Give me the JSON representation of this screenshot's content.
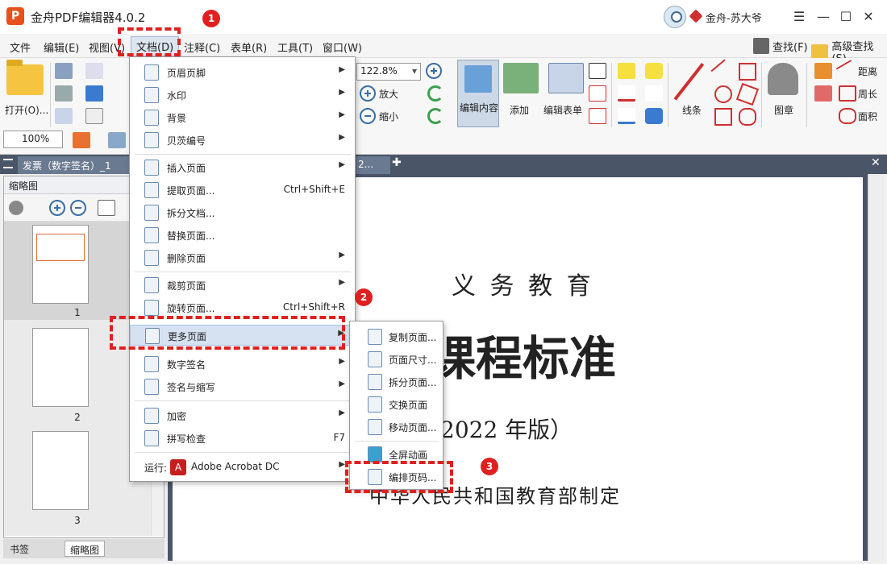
{
  "window": {
    "title": "金舟PDF编辑器4.0.2",
    "logo_letter": "P",
    "user_name": "金舟-苏大爷",
    "controls": [
      "☰",
      "—",
      "☐",
      "✕"
    ]
  },
  "menubar": {
    "items": [
      "文件",
      "编辑(E)",
      "视图(V)",
      "文档(D)",
      "注释(C)",
      "表单(R)",
      "工具(T)",
      "窗口(W)"
    ],
    "find_label": "查找(F)",
    "advanced_find_label": "高级查找(S)"
  },
  "toolbar": {
    "open_label": "打开(O)...",
    "zoom_value": "122.8%",
    "zoom_in_label": "放大",
    "zoom_out_label": "缩小",
    "edit_content_label": "编辑内容",
    "add_label": "添加",
    "edit_form_label": "编辑表单",
    "line_label": "线条",
    "stamp_label": "图章",
    "distance_label": "距离",
    "perimeter_label": "周长",
    "area_label": "面积",
    "view_zoom_value": "100%"
  },
  "tabs": {
    "doc_tab_label": "发票（数字签名）_1",
    "doc_tab2_label": "2..."
  },
  "sidepanel": {
    "header": "缩略图",
    "pages": [
      "1",
      "2",
      "3"
    ],
    "bottom_tabs": [
      "书签",
      "缩略图"
    ]
  },
  "document": {
    "line1": "义 务 教 育",
    "line2": "文课程标准",
    "line3": "（2022 年版）",
    "line4": "中华人民共和国教育部制定"
  },
  "doc_menu": {
    "items": [
      {
        "label": "页眉页脚",
        "shortcut": "",
        "submenu": true
      },
      {
        "label": "水印",
        "shortcut": "",
        "submenu": true
      },
      {
        "label": "背景",
        "shortcut": "",
        "submenu": true
      },
      {
        "label": "贝茨编号",
        "shortcut": "",
        "submenu": true
      },
      {
        "label": "插入页面",
        "shortcut": "",
        "submenu": true
      },
      {
        "label": "提取页面...",
        "shortcut": "Ctrl+Shift+E",
        "submenu": false
      },
      {
        "label": "拆分文档...",
        "shortcut": "",
        "submenu": false
      },
      {
        "label": "替换页面...",
        "shortcut": "",
        "submenu": false
      },
      {
        "label": "删除页面",
        "shortcut": "",
        "submenu": true
      },
      {
        "label": "裁剪页面",
        "shortcut": "",
        "submenu": true
      },
      {
        "label": "旋转页面...",
        "shortcut": "Ctrl+Shift+R",
        "submenu": false
      },
      {
        "label": "更多页面",
        "shortcut": "",
        "submenu": true
      },
      {
        "label": "数字签名",
        "shortcut": "",
        "submenu": true
      },
      {
        "label": "签名与缩写",
        "shortcut": "",
        "submenu": true
      },
      {
        "label": "加密",
        "shortcut": "",
        "submenu": true
      },
      {
        "label": "拼写检查",
        "shortcut": "F7",
        "submenu": false
      }
    ],
    "run_label": "运行:",
    "run_app": "Adobe Acrobat DC"
  },
  "more_pages_submenu": {
    "items": [
      "复制页面...",
      "页面尺寸...",
      "拆分页面...",
      "交换页面",
      "移动页面...",
      "全屏动画",
      "编排页码..."
    ]
  },
  "annotations": {
    "badges": [
      "1",
      "2",
      "3"
    ],
    "color": "#e02020"
  }
}
